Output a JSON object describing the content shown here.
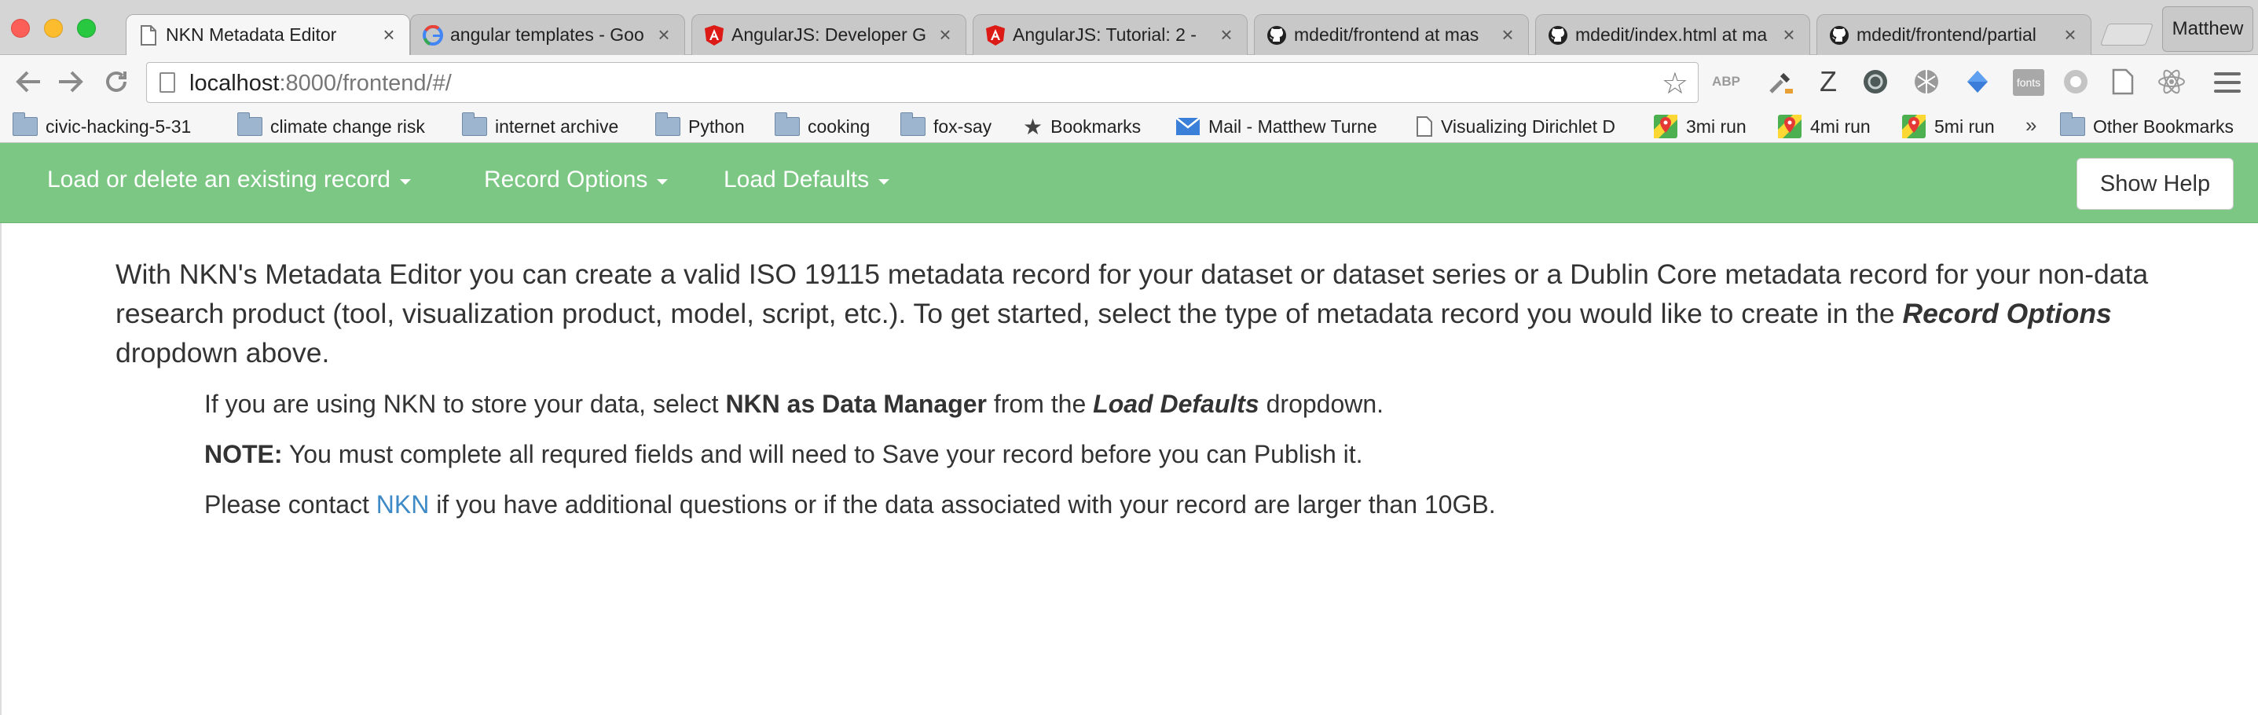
{
  "browser": {
    "tabs": [
      {
        "title": "NKN Metadata Editor",
        "icon": "page-icon",
        "active": true
      },
      {
        "title": "angular templates - Goo",
        "icon": "google-icon",
        "active": false
      },
      {
        "title": "AngularJS: Developer G",
        "icon": "angular-icon",
        "active": false
      },
      {
        "title": "AngularJS: Tutorial: 2 -",
        "icon": "angular-icon",
        "active": false
      },
      {
        "title": "mdedit/frontend at mas",
        "icon": "github-icon",
        "active": false
      },
      {
        "title": "mdedit/index.html at ma",
        "icon": "github-icon",
        "active": false
      },
      {
        "title": "mdedit/frontend/partial",
        "icon": "github-icon",
        "active": false
      }
    ],
    "close_glyph": "×",
    "profile_name": "Matthew",
    "url": {
      "host": "localhost",
      "path": ":8000/frontend/#/"
    },
    "bookmarks": [
      {
        "label": "civic-hacking-5-31",
        "icon": "folder-icon"
      },
      {
        "label": "climate change risk",
        "icon": "folder-icon"
      },
      {
        "label": "internet archive",
        "icon": "folder-icon"
      },
      {
        "label": "Python",
        "icon": "folder-icon"
      },
      {
        "label": "cooking",
        "icon": "folder-icon"
      },
      {
        "label": "fox-say",
        "icon": "folder-icon"
      },
      {
        "label": "Bookmarks",
        "icon": "star-icon"
      },
      {
        "label": "Mail - Matthew Turne",
        "icon": "mail-icon"
      },
      {
        "label": "Visualizing Dirichlet D",
        "icon": "page-icon"
      },
      {
        "label": "3mi run",
        "icon": "maps-icon"
      },
      {
        "label": "4mi run",
        "icon": "maps-icon"
      },
      {
        "label": "5mi run",
        "icon": "maps-icon"
      },
      {
        "label": "Other Bookmarks",
        "icon": "folder-icon"
      }
    ],
    "overflow_chevron": "»",
    "extensions": [
      "abp",
      "eyedropper",
      "z",
      "shield",
      "globe",
      "diamond",
      "fonts",
      "circle",
      "page",
      "react"
    ],
    "abp_label": "ABP",
    "z_label": "Z",
    "fonts_label": "fonts"
  },
  "navbar": {
    "menu_load": "Load or delete an existing record",
    "menu_record_options": "Record Options",
    "menu_load_defaults": "Load Defaults",
    "help_button": "Show Help",
    "bg_color": "#7cc784"
  },
  "content": {
    "intro_1": "With NKN's Metadata Editor you can create a valid ISO 19115 metadata record for your dataset or dataset series or a Dublin Core metadata record for your non-data research product (tool, visualization product, model, script, etc.). To get started, select the type of metadata record you would like to create in the ",
    "intro_bold": "Record Options",
    "intro_2": " dropdown above.",
    "line1_a": "If you are using NKN to store your data, select ",
    "line1_bold": "NKN as Data Manager",
    "line1_b": " from the ",
    "line1_bold_italic": "Load Defaults",
    "line1_c": " dropdown.",
    "line2_bold": "NOTE:",
    "line2_rest": " You must complete all requred fields and will need to Save your record before you can Publish it.",
    "line3_a": "Please contact ",
    "line3_link": "NKN",
    "line3_b": " if you have additional questions or if the data associated with your record are larger than 10GB."
  }
}
